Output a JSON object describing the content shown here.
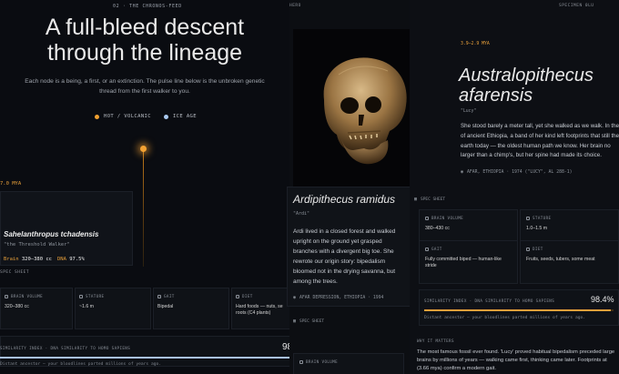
{
  "left": {
    "tag": "02 · THE CHRONOS-FEED",
    "hero_title": "A full-bleed descent through the lineage",
    "hero_subtitle": "Each node is a being, a first, or an extinction. The pulse line below is the unbroken genetic thread from the first walker to you.",
    "legend": [
      {
        "label": "HOT / VOLCANIC",
        "color": "#f0a030"
      },
      {
        "label": "ICE AGE",
        "color": "#a9c8ef"
      }
    ],
    "mya": "7.0 MYA",
    "species_name": "Sahelanthropus tchadensis",
    "nickname": "\"the Threshold Walker\"",
    "brain_label": "Brain",
    "brain_value": "320–380 cc",
    "dna_label": "DNA",
    "dna_value": "97.5%",
    "spec_sheet_label": "SPEC SHEET",
    "specs": [
      {
        "label": "BRAIN VOLUME",
        "value": "320–380 cc"
      },
      {
        "label": "STATURE",
        "value": "~1.6 m"
      },
      {
        "label": "GAIT",
        "value": "Bipedal"
      },
      {
        "label": "DIET",
        "value": "Hard foods — nuts, se roots (C4 plants)"
      }
    ],
    "similarity_label": "SIMILARITY INDEX · DNA SIMILARITY TO HOMO SAPIENS",
    "similarity_value": "98",
    "similarity_fraction": 0.98,
    "similarity_note": "Distant ancestor — your bloodlines parted millions of years ago."
  },
  "middle": {
    "tag": "HERO",
    "species_name": "Ardipithecus ramidus",
    "nickname": "\"Ardi\"",
    "description": "Ardi lived in a closed forest and walked upright on the ground yet grasped branches with a divergent big toe. She rewrote our origin story: bipedalism bloomed not in the drying savanna, but among the trees.",
    "location": "AFAR DEPRESSION, ETHIOPIA · 1994",
    "spec_sheet_label": "SPEC SHEET",
    "brain_label": "BRAIN VOLUME"
  },
  "right": {
    "tag": "SPECIMEN 0LU",
    "mya": "3.9–2.9 MYA",
    "species_name": "Australopithecus afarensis",
    "nickname": "\"Lucy\"",
    "description": "She stood barely a meter tall, yet she walked as we walk. In the of ancient Ethiopia, a band of her kind left footprints that still the earth today — the oldest human path we know. Her brain no larger than a chimp's, but her spine had made its choice.",
    "location": "AFAR, ETHIOPIA · 1974 (\"LUCY\", AL 288-1)",
    "spec_sheet_label": "SPEC SHEET",
    "specs": [
      {
        "label": "BRAIN VOLUME",
        "value": "380–430 cc"
      },
      {
        "label": "STATURE",
        "value": "1.0–1.5 m"
      },
      {
        "label": "GAIT",
        "value": "Fully committed biped — human-like stride"
      },
      {
        "label": "DIET",
        "value": "Fruits, seeds, tubers, some meat"
      }
    ],
    "similarity_label": "SIMILARITY INDEX · DNA SIMILARITY TO HOMO SAPIENS",
    "similarity_value": "98.4%",
    "similarity_fraction": 0.984,
    "similarity_note": "Distant ancestor — your bloodlines parted millions of years ago.",
    "why_label": "WHY IT MATTERS",
    "why_text": "The most famous fossil ever found. 'Lucy' proved habitual bipedalism preceded large brains by millions of years — walking came first, thinking came later. Footprints at (3.66 mya) confirm a modern gait."
  }
}
